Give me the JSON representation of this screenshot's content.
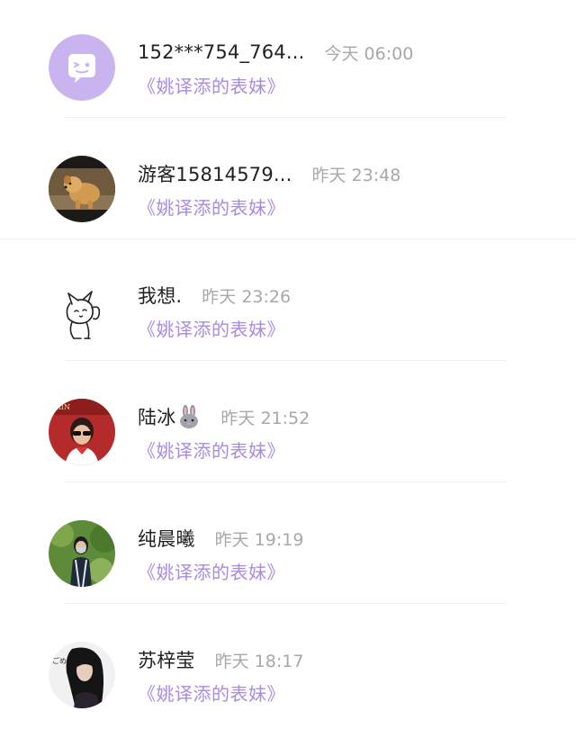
{
  "comments": [
    {
      "avatar": "default-chat-bubble-avatar",
      "name": "152***754_764...",
      "time": "今天 06:00",
      "title": "《姚译添的表妹》"
    },
    {
      "avatar": "puppy-photo-avatar",
      "name": "游客15814579...",
      "time": "昨天 23:48",
      "title": "《姚译添的表妹》"
    },
    {
      "avatar": "cartoon-cat-sketch-avatar",
      "name": "我想.",
      "time": "昨天 23:26",
      "title": "《姚译添的表妹》"
    },
    {
      "avatar": "person-sunglasses-red-avatar",
      "name": "陆冰",
      "name_emoji": "rabbit-emoji",
      "time": "昨天 21:52",
      "title": "《姚译添的表妹》"
    },
    {
      "avatar": "person-green-outdoor-avatar",
      "name": "纯晨曦",
      "time": "昨天 19:19",
      "title": "《姚译添的表妹》"
    },
    {
      "avatar": "girl-dark-hair-avatar",
      "name": "苏梓莹",
      "time": "昨天 18:17",
      "title": "《姚译添的表妹》"
    }
  ],
  "colors": {
    "name": "#222222",
    "time": "#a8a8a8",
    "title_link": "#a98be0",
    "default_avatar_bg": "#c9b4ef",
    "divider": "#eeeeee"
  }
}
